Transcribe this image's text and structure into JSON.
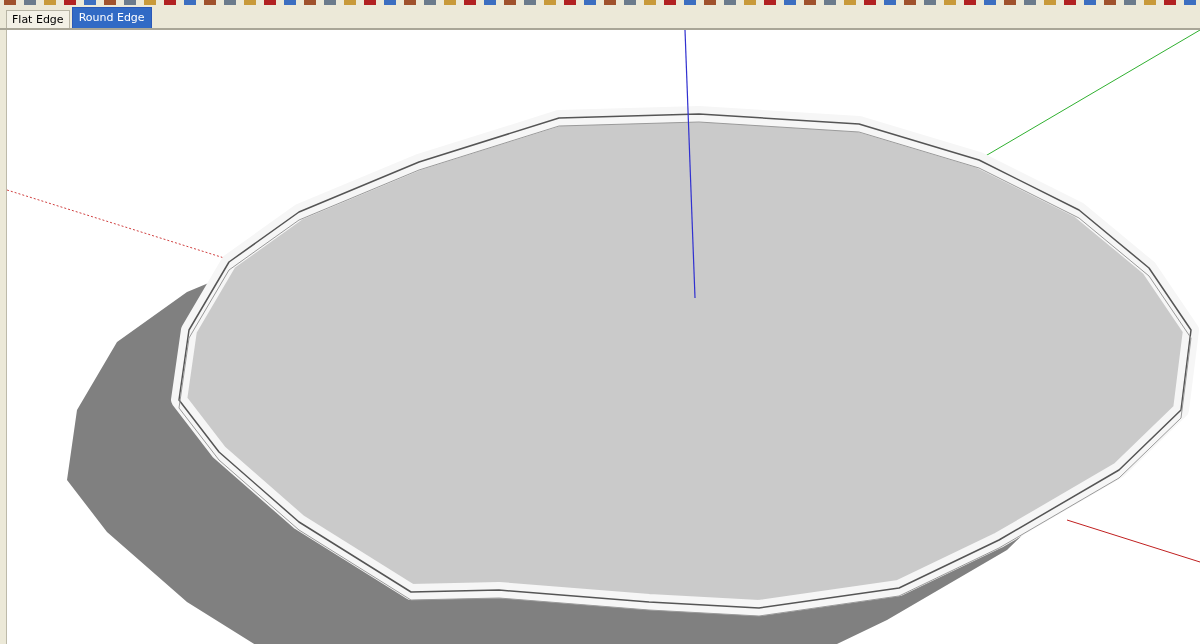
{
  "scene_tabs": [
    {
      "label": "Flat Edge",
      "selected": false
    },
    {
      "label": "Round Edge",
      "selected": true
    }
  ]
}
